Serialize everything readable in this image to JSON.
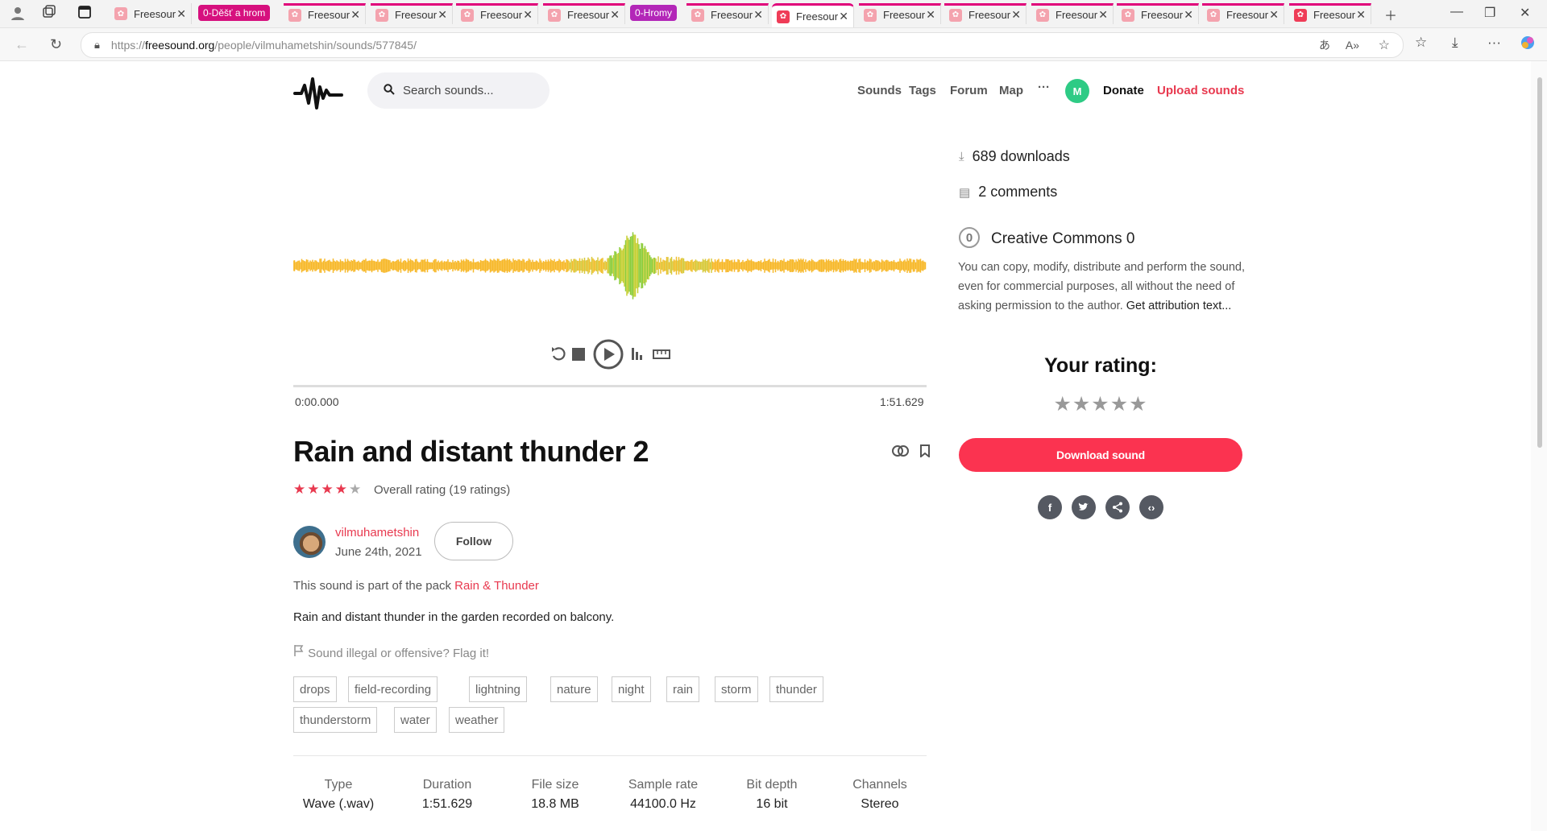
{
  "browser": {
    "tabs": [
      {
        "label": "Freesour"
      },
      {
        "label": "Freesour"
      },
      {
        "label": "Freesour"
      },
      {
        "label": "Freesour"
      },
      {
        "label": "Freesour"
      },
      {
        "label": "Freesour"
      },
      {
        "label": "Freesour"
      },
      {
        "label": "Freesour"
      },
      {
        "label": "Freesour"
      },
      {
        "label": "Freesour"
      },
      {
        "label": "Freesour"
      },
      {
        "label": "Freesour"
      },
      {
        "label": "Freesour"
      }
    ],
    "group_labels": [
      "0-Děšť a hrom",
      "0-Hromy"
    ],
    "url": "https://freesound.org/people/vilmuhametshin/sounds/577845/",
    "url_host": "freesound.org",
    "url_path": "/people/vilmuhametshin/sounds/577845/"
  },
  "header": {
    "search_placeholder": "Search sounds...",
    "nav": [
      "Sounds",
      "Tags",
      "Forum",
      "Map"
    ],
    "more": "···",
    "avatar_initial": "M",
    "donate": "Donate",
    "upload": "Upload sounds"
  },
  "player": {
    "time_start": "0:00.000",
    "time_end": "1:51.629"
  },
  "sound": {
    "title": "Rain and distant thunder 2",
    "rating_text": "Overall rating (19 ratings)",
    "rating_value": 4,
    "username": "vilmuhametshin",
    "date": "June 24th, 2021",
    "follow": "Follow",
    "pack_prefix": "This sound is part of the pack",
    "pack_name": "Rain & Thunder",
    "description": "Rain and distant thunder in the garden recorded on balcony.",
    "flag": "Sound illegal or offensive? Flag it!",
    "tags": [
      "drops",
      "field-recording",
      "lightning",
      "nature",
      "night",
      "rain",
      "storm",
      "thunder",
      "thunderstorm",
      "water",
      "weather"
    ],
    "meta": [
      {
        "h": "Type",
        "v": "Wave (.wav)"
      },
      {
        "h": "Duration",
        "v": "1:51.629"
      },
      {
        "h": "File size",
        "v": "18.8 MB"
      },
      {
        "h": "Sample rate",
        "v": "44100.0 Hz"
      },
      {
        "h": "Bit depth",
        "v": "16 bit"
      },
      {
        "h": "Channels",
        "v": "Stereo"
      }
    ]
  },
  "sidebar": {
    "downloads": "689 downloads",
    "comments": "2 comments",
    "license_title": "Creative Commons 0",
    "license_text": "You can copy, modify, distribute and perform the sound, even for commercial purposes, all without the need of asking permission to the author.",
    "license_link": "Get attribution text...",
    "your_rating": "Your rating:",
    "download_button": "Download sound"
  },
  "colors": {
    "accent": "#e8394f",
    "download": "#fb3350",
    "avatar": "#2ecb85"
  }
}
